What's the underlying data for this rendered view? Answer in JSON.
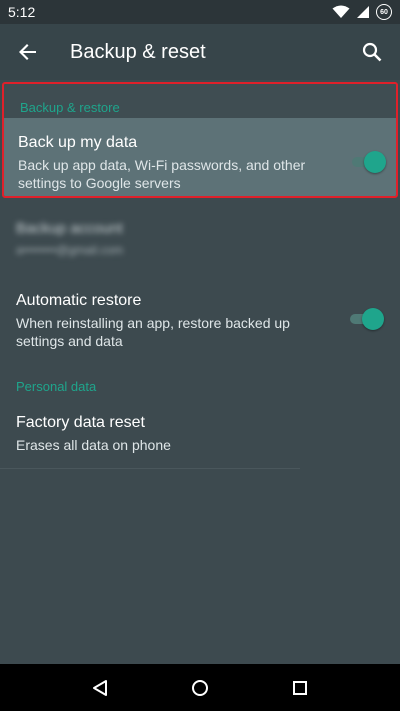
{
  "status_bar": {
    "time": "5:12",
    "battery": "60"
  },
  "toolbar": {
    "title": "Backup & reset"
  },
  "sections": {
    "backup_restore_header": "Backup & restore",
    "personal_data_header": "Personal data"
  },
  "settings": {
    "backup_my_data": {
      "title": "Back up my data",
      "subtitle": "Back up app data, Wi-Fi passwords, and other settings to Google servers",
      "enabled": true
    },
    "backup_account": {
      "title": "Backup account",
      "subtitle": "a••••••••@gmail.com"
    },
    "automatic_restore": {
      "title": "Automatic restore",
      "subtitle": "When reinstalling an app, restore backed up settings and data",
      "enabled": true
    },
    "factory_reset": {
      "title": "Factory data reset",
      "subtitle": "Erases all data on phone"
    }
  },
  "colors": {
    "accent": "#1fa58c",
    "highlight_border": "#e0202a",
    "background": "#3d4a4f"
  }
}
